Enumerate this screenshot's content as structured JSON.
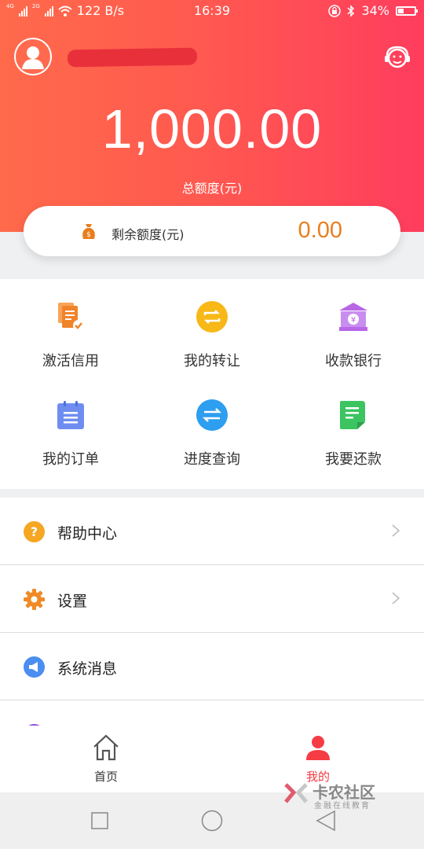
{
  "status": {
    "network_labels": [
      "4G",
      "2G"
    ],
    "speed": "122 B/s",
    "time": "16:39",
    "battery": "34%",
    "battery_level": 0.34
  },
  "header": {
    "amount": "1,000.00",
    "amount_label": "总额度(元)"
  },
  "remaining": {
    "label": "剩余额度(元)",
    "value": "0.00"
  },
  "grid": [
    {
      "label": "激活信用",
      "icon": "document-check-icon",
      "color": "#f0842a"
    },
    {
      "label": "我的转让",
      "icon": "transfer-cycle-icon",
      "color": "#f7b818"
    },
    {
      "label": "收款银行",
      "icon": "bank-icon",
      "color": "#b865e6"
    },
    {
      "label": "我的订单",
      "icon": "order-clipboard-icon",
      "color": "#6f8df1"
    },
    {
      "label": "进度查询",
      "icon": "exchange-arrows-icon",
      "color": "#2d9ef0"
    },
    {
      "label": "我要还款",
      "icon": "repay-note-icon",
      "color": "#3cc460"
    }
  ],
  "menu": [
    {
      "label": "帮助中心",
      "icon": "help-icon",
      "color": "#f5a623"
    },
    {
      "label": "设置",
      "icon": "gear-icon",
      "color": "#ef8a26"
    },
    {
      "label": "系统消息",
      "icon": "megaphone-icon",
      "color": "#4a8ef0"
    },
    {
      "label": "",
      "icon": "partial-row-icon",
      "color": "#8e4ad8"
    }
  ],
  "tabs": [
    {
      "label": "首页",
      "icon": "home-icon"
    },
    {
      "label": "我的",
      "icon": "profile-icon"
    }
  ],
  "watermark": {
    "title": "卡农社区",
    "subtitle": "金融在线教育"
  },
  "colors": {
    "accent": "#ff4a56",
    "amount_orange": "#ea7d1d"
  }
}
